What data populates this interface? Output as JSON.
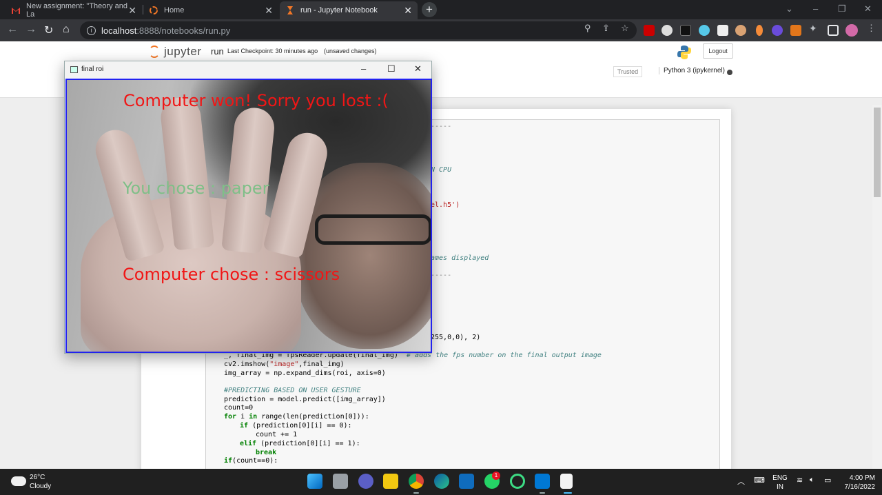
{
  "browser": {
    "tabs": [
      {
        "title": "New assignment: \"Theory and La",
        "icon": "gmail-icon",
        "active": false
      },
      {
        "title": "Home",
        "icon": "jupyter-icon",
        "active": false
      },
      {
        "title": "run - Jupyter Notebook",
        "icon": "hourglass-icon",
        "active": true
      }
    ],
    "new_tab": "+",
    "url_host": "localhost",
    "url_path": ":8888/notebooks/run.py"
  },
  "jupyter": {
    "logo_text": "jupyter",
    "notebook_name": "run",
    "checkpoint": "Last Checkpoint: 30 minutes ago",
    "unsaved": "(unsaved changes)",
    "logout": "Logout",
    "trusted": "Trusted",
    "kernel": "Python 3 (ipykernel)"
  },
  "code_fragments": {
    "dash1": "-----",
    "cpu": "N CPU",
    "h5": "el.h5')",
    "frames": "ames displayed",
    "dash2": "-----",
    "color": "255,0,0), 2)",
    "fps_code": "_, final_img = fpsReader.update(final_img)",
    "fps_comment": "# adds the fps number on the final output image",
    "imshow_a": "cv2.imshow(",
    "imshow_str": "\"image\"",
    "imshow_b": ",final_img)",
    "img_array": "img_array = np.expand_dims(roi, axis=0)",
    "predict_comment": "#PREDICTING BASED ON USER GESTURE",
    "prediction": "prediction = model.predict([img_array])",
    "count0": "count=0",
    "for_kw": "for",
    "for_a": " i ",
    "for_in": "in",
    "for_b": " range(len(prediction[0])):",
    "if_kw": "if",
    "if_rest": " (prediction[0][i] == 0):",
    "count_inc": "count += 1",
    "elif_kw": "elif",
    "elif_rest": " (prediction[0][i] == 1):",
    "break_kw": "break",
    "if_count_kw": "if",
    "if_count_rest": "(count==0):"
  },
  "roi_window": {
    "title": "final roi",
    "result": "Computer won! Sorry you lost :(",
    "user_choice": "You chose : paper",
    "computer_choice": "Computer chose : scissors",
    "result_color": "#f01616",
    "user_color": "#7fbf88"
  },
  "taskbar": {
    "temperature": "26°C",
    "weather": "Cloudy",
    "lang_top": "ENG",
    "lang_bottom": "IN",
    "time": "4:00 PM",
    "date": "7/16/2022",
    "whatsapp_badge": "1"
  }
}
